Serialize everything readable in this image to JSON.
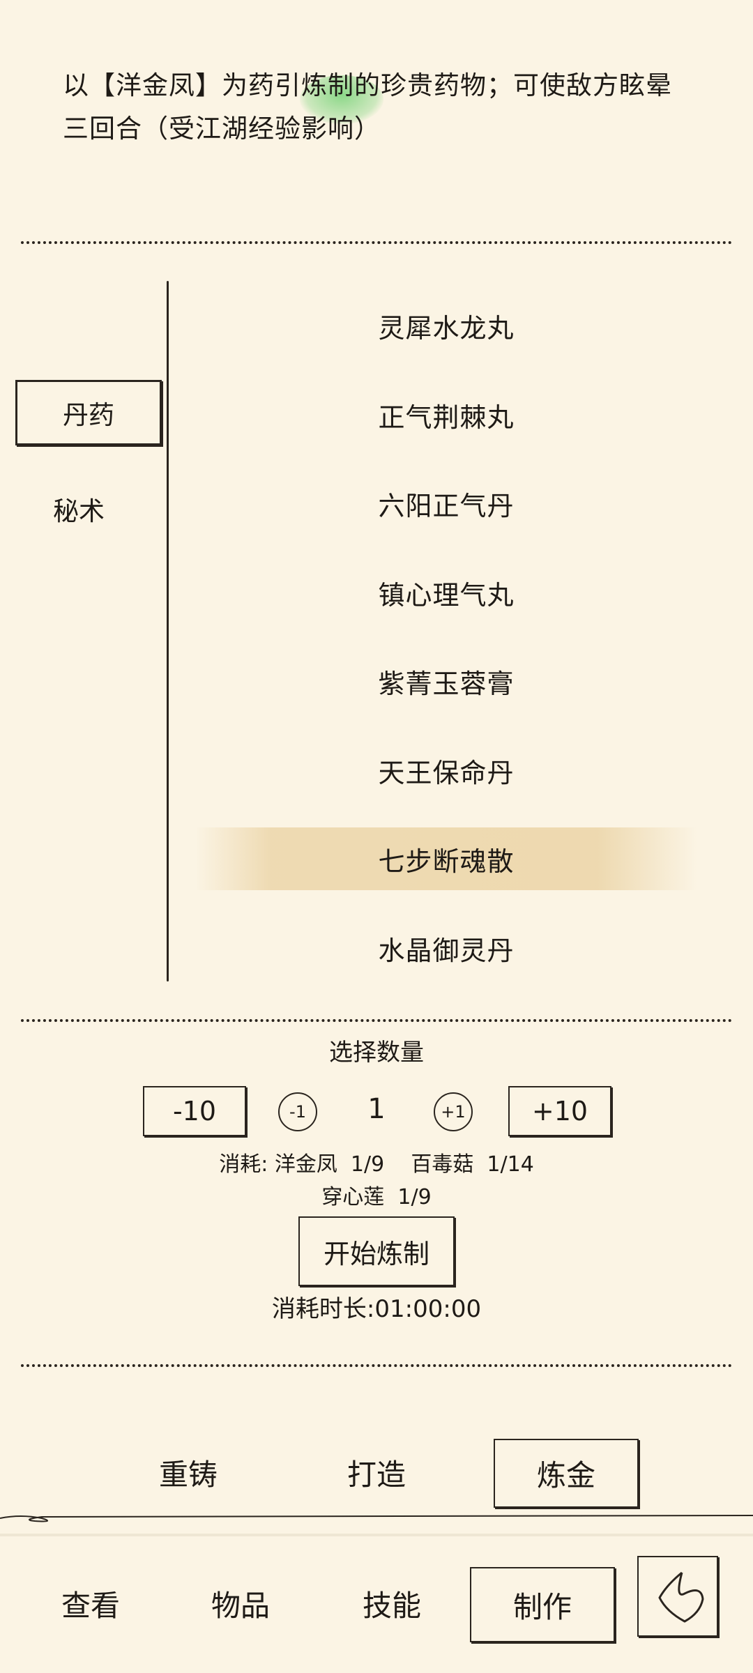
{
  "description": {
    "line1": "以【洋金凤】为药引炼制的珍贵药物；可使敌方眩晕",
    "line2": "三回合（受江湖经验影响）"
  },
  "categories": [
    "丹药",
    "秘术"
  ],
  "recipes": [
    "灵犀水龙丸",
    "正气荆棘丸",
    "六阳正气丹",
    "镇心理气丸",
    "紫菁玉蓉膏",
    "天王保命丹",
    "七步断魂散",
    "水晶御灵丹"
  ],
  "selected_recipe": "七步断魂散",
  "quantity": {
    "title": "选择数量",
    "minus10": "-10",
    "minus1": "-1",
    "value": "1",
    "plus1": "+1",
    "plus10": "+10"
  },
  "cost": {
    "line1": "消耗: 洋金凤  1/9    百毒菇  1/14",
    "line2": "穿心莲  1/9"
  },
  "start_button": "开始炼制",
  "duration": "消耗时长:01:00:00",
  "craft_tabs": [
    "重铸",
    "打造",
    "炼金"
  ],
  "craft_tab_active": "炼金",
  "nav_tabs": [
    "查看",
    "物品",
    "技能",
    "制作"
  ],
  "nav_tab_active": "制作",
  "back_icon": "back-arrow-icon"
}
